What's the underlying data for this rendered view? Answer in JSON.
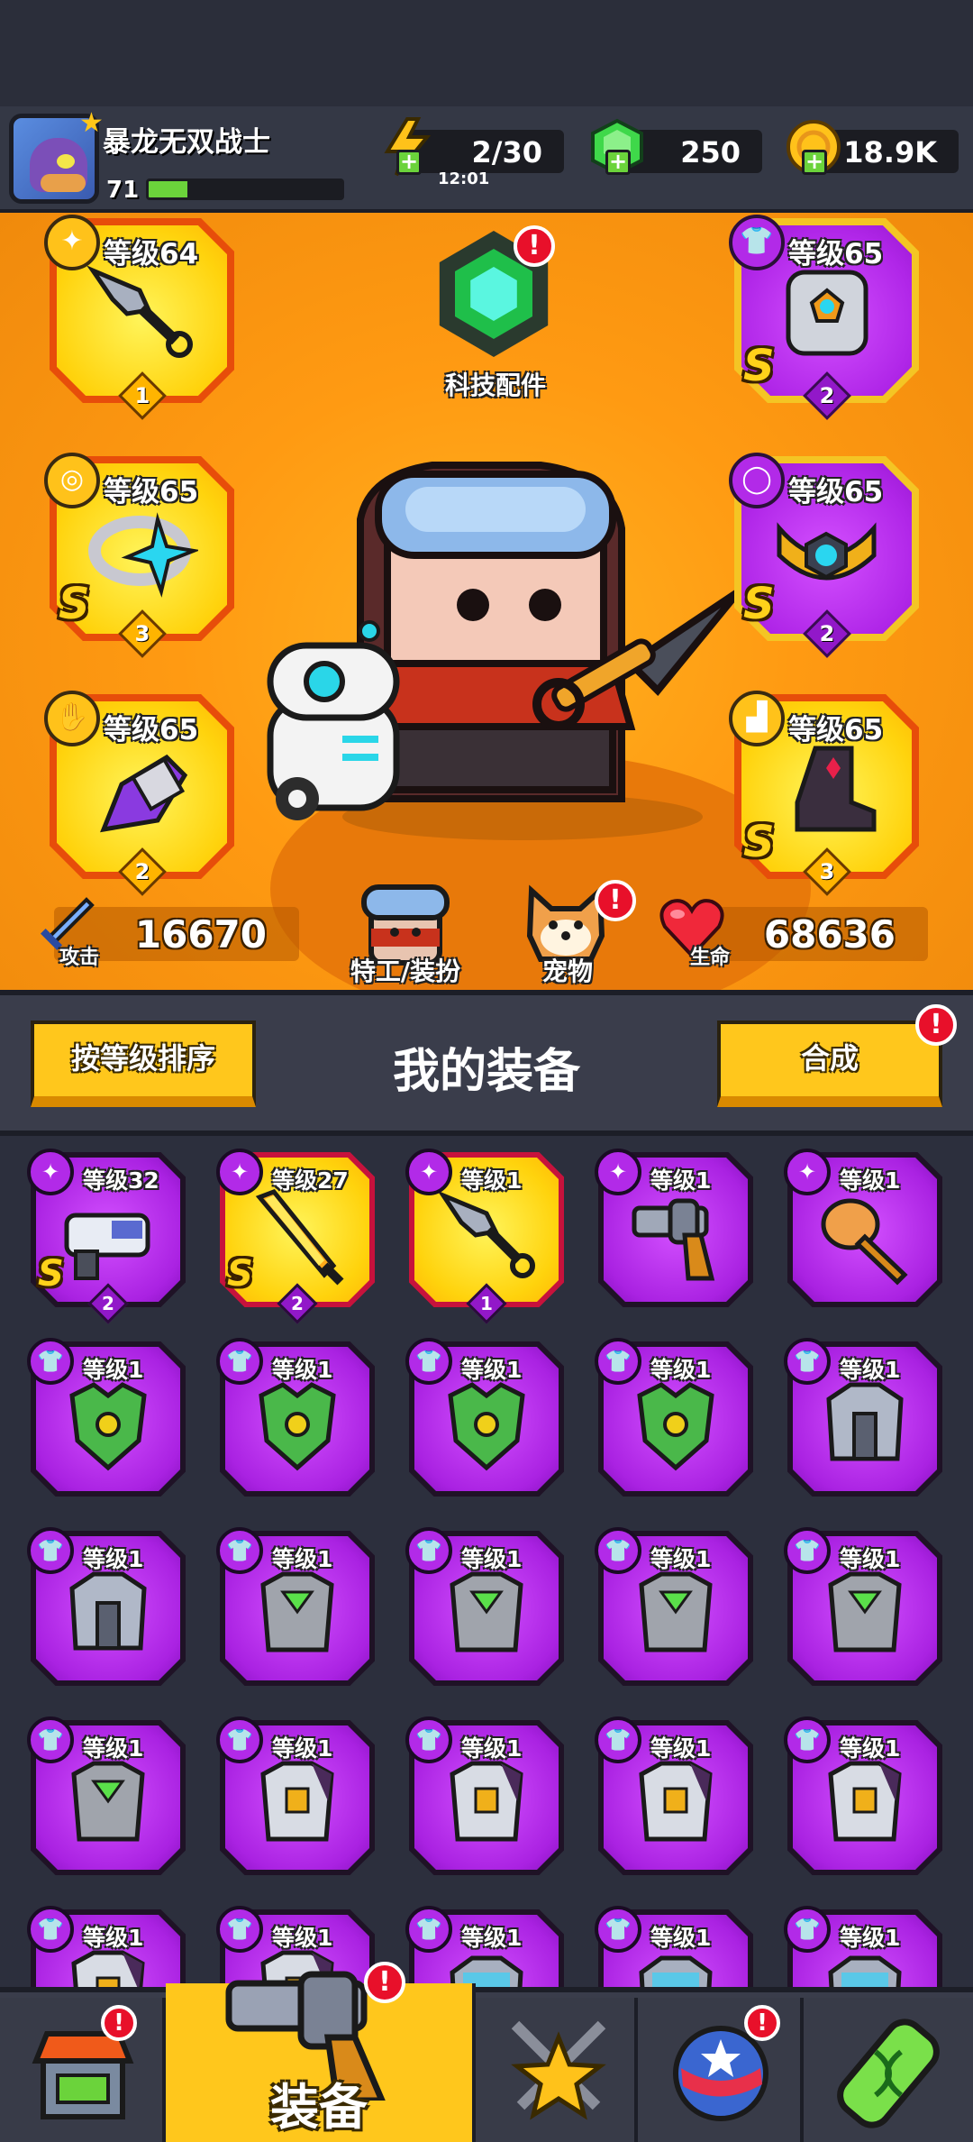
{
  "player": {
    "name": "暴龙无双战士",
    "level": "71",
    "xp_fraction": 0.2
  },
  "resources": {
    "energy": "2/30",
    "energy_timer": "12:01",
    "gems": "250",
    "coins": "18.9K"
  },
  "equipped": {
    "left": [
      {
        "level": "等级64",
        "stars": "1",
        "rarity_badge": "",
        "icon": "kunai-icon",
        "type_icon": "weapon-type-icon"
      },
      {
        "level": "等级65",
        "stars": "3",
        "rarity_badge": "S",
        "icon": "ring-icon",
        "type_icon": "ring-type-icon"
      },
      {
        "level": "等级65",
        "stars": "2",
        "rarity_badge": "",
        "icon": "glove-icon",
        "type_icon": "glove-type-icon"
      }
    ],
    "right": [
      {
        "level": "等级65",
        "stars": "2",
        "rarity_badge": "S",
        "icon": "armor-icon",
        "type_icon": "armor-type-icon"
      },
      {
        "level": "等级65",
        "stars": "2",
        "rarity_badge": "S",
        "icon": "belt-icon",
        "type_icon": "belt-type-icon"
      },
      {
        "level": "等级65",
        "stars": "3",
        "rarity_badge": "S",
        "icon": "boots-icon",
        "type_icon": "boots-type-icon"
      }
    ]
  },
  "tech_parts": {
    "label": "科技配件"
  },
  "stats": {
    "attack_label": "攻击",
    "attack_value": "16670",
    "hp_label": "生命",
    "hp_value": "68636",
    "agent_label": "特工/装扮",
    "pet_label": "宠物"
  },
  "section": {
    "sort_button": "按等级排序",
    "title": "我的装备",
    "merge_button": "合成"
  },
  "inventory": [
    {
      "level": "等级32",
      "stars": "2",
      "rarity_badge": "S",
      "style": "purple",
      "icon": "blaster-icon"
    },
    {
      "level": "等级27",
      "stars": "2",
      "rarity_badge": "S",
      "style": "gold",
      "icon": "flame-sword-icon"
    },
    {
      "level": "等级1",
      "stars": "1",
      "rarity_badge": "",
      "style": "gold",
      "icon": "kunai-icon"
    },
    {
      "level": "等级1",
      "stars": "",
      "rarity_badge": "",
      "style": "purple",
      "icon": "revolver-icon"
    },
    {
      "level": "等级1",
      "stars": "",
      "rarity_badge": "",
      "style": "purple",
      "icon": "torch-icon"
    },
    {
      "level": "等级1",
      "stars": "",
      "rarity_badge": "",
      "style": "purple",
      "icon": "green-armor-icon"
    },
    {
      "level": "等级1",
      "stars": "",
      "rarity_badge": "",
      "style": "purple",
      "icon": "green-armor-icon"
    },
    {
      "level": "等级1",
      "stars": "",
      "rarity_badge": "",
      "style": "purple",
      "icon": "green-armor-icon"
    },
    {
      "level": "等级1",
      "stars": "",
      "rarity_badge": "",
      "style": "purple",
      "icon": "green-armor-icon"
    },
    {
      "level": "等级1",
      "stars": "",
      "rarity_badge": "",
      "style": "purple",
      "icon": "steel-armor-icon"
    },
    {
      "level": "等级1",
      "stars": "",
      "rarity_badge": "",
      "style": "purple",
      "icon": "steel-armor-icon"
    },
    {
      "level": "等级1",
      "stars": "",
      "rarity_badge": "",
      "style": "purple",
      "icon": "gray-armor-icon"
    },
    {
      "level": "等级1",
      "stars": "",
      "rarity_badge": "",
      "style": "purple",
      "icon": "gray-armor-icon"
    },
    {
      "level": "等级1",
      "stars": "",
      "rarity_badge": "",
      "style": "purple",
      "icon": "gray-armor-icon"
    },
    {
      "level": "等级1",
      "stars": "",
      "rarity_badge": "",
      "style": "purple",
      "icon": "gray-armor-icon"
    },
    {
      "level": "等级1",
      "stars": "",
      "rarity_badge": "",
      "style": "purple",
      "icon": "gray-armor-icon"
    },
    {
      "level": "等级1",
      "stars": "",
      "rarity_badge": "",
      "style": "purple",
      "icon": "plate-armor-icon"
    },
    {
      "level": "等级1",
      "stars": "",
      "rarity_badge": "",
      "style": "purple",
      "icon": "plate-armor-icon"
    },
    {
      "level": "等级1",
      "stars": "",
      "rarity_badge": "",
      "style": "purple",
      "icon": "plate-armor-icon"
    },
    {
      "level": "等级1",
      "stars": "",
      "rarity_badge": "",
      "style": "purple",
      "icon": "plate-armor-icon"
    },
    {
      "level": "等级1",
      "stars": "",
      "rarity_badge": "",
      "style": "purple",
      "icon": "plate-armor-icon"
    },
    {
      "level": "等级1",
      "stars": "",
      "rarity_badge": "",
      "style": "purple",
      "icon": "plate-armor-icon"
    },
    {
      "level": "等级1",
      "stars": "",
      "rarity_badge": "",
      "style": "purple",
      "icon": "mech-armor-icon"
    },
    {
      "level": "等级1",
      "stars": "",
      "rarity_badge": "",
      "style": "purple",
      "icon": "mech-armor-icon"
    },
    {
      "level": "等级1",
      "stars": "",
      "rarity_badge": "",
      "style": "purple",
      "icon": "mech-armor-icon"
    }
  ],
  "bottom_nav": [
    {
      "label": "",
      "icon": "shop-icon",
      "alert": true
    },
    {
      "label": "装备",
      "icon": "revolver-icon",
      "alert": true,
      "active": true
    },
    {
      "label": "",
      "icon": "battle-star-icon",
      "alert": false
    },
    {
      "label": "",
      "icon": "planet-icon",
      "alert": true
    },
    {
      "label": "",
      "icon": "gene-capsule-icon",
      "alert": false
    }
  ],
  "colors": {
    "accent_yellow": "#ffc71c",
    "stage_orange": "#ff9a12",
    "epic_purple": "#b026e8",
    "alert_red": "#e8102a"
  }
}
